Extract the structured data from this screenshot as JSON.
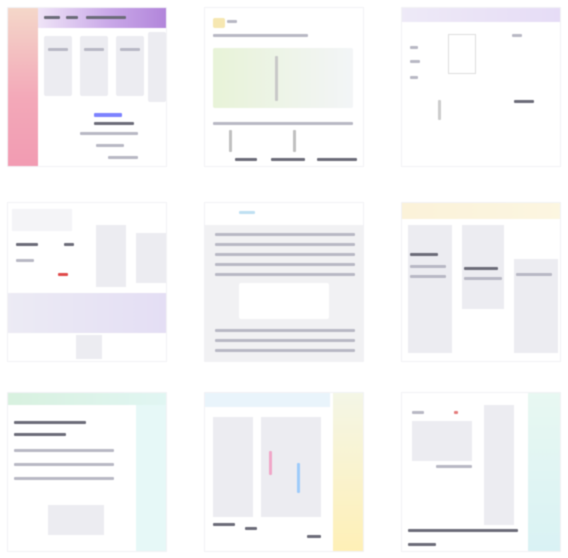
{
  "gallery": {
    "tiles": [
      {
        "theme": "pink-purple dashboard",
        "accent": "#f2a7b9"
      },
      {
        "theme": "pale document with table",
        "accent": "#e6f2d8"
      },
      {
        "theme": "lavender header app",
        "accent": "#e9e2f6"
      },
      {
        "theme": "pale settings page",
        "accent": "#f0e6f7"
      },
      {
        "theme": "gray article page",
        "accent": "#f2f2f2"
      },
      {
        "theme": "yellow header news page",
        "accent": "#fcf4d8"
      },
      {
        "theme": "green header form",
        "accent": "#dff3e6"
      },
      {
        "theme": "sidebar document editor",
        "accent": "#fff6cf"
      },
      {
        "theme": "cyan sidebar dashboard",
        "accent": "#dff5f4"
      }
    ]
  }
}
